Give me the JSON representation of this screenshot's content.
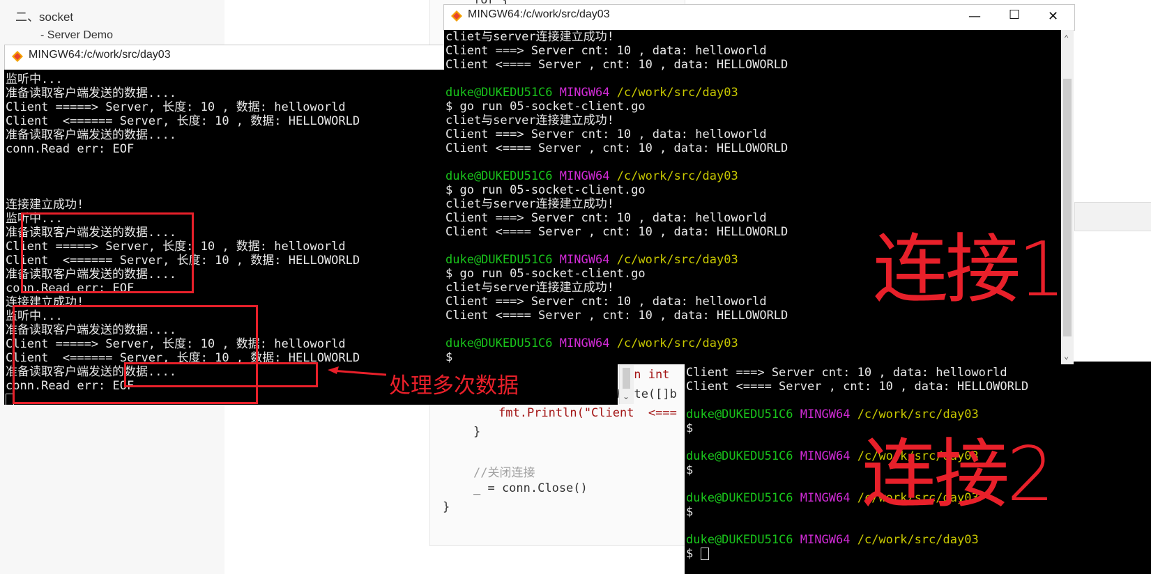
{
  "doc": {
    "toc_section": "二、socket",
    "toc_item": "- Server Demo"
  },
  "code": {
    "l1": "for {",
    "l2": "(n int",
    "l3": "cnt, err = conn.Write([]b",
    "l4_a": "fmt.Println(\"Client  <===",
    "l5": "}",
    "l6": "//关闭连接",
    "l7": "_ = conn.Close()",
    "l8": "}"
  },
  "win1": {
    "title": "MINGW64:/c/work/src/day03",
    "lines": [
      "监听中...",
      "准备读取客户端发送的数据....",
      "Client =====> Server, 长度: 10 , 数据: helloworld",
      "Client  <====== Server, 长度: 10 , 数据: HELLOWORLD",
      "准备读取客户端发送的数据....",
      "conn.Read err: EOF",
      "",
      "",
      "",
      "连接建立成功!",
      "监听中...",
      "准备读取客户端发送的数据....",
      "Client =====> Server, 长度: 10 , 数据: helloworld",
      "Client  <====== Server, 长度: 10 , 数据: HELLOWORLD",
      "准备读取客户端发送的数据....",
      "conn.Read err: EOF",
      "连接建立成功!",
      "监听中...",
      "准备读取客户端发送的数据....",
      "Client =====> Server, 长度: 10 , 数据: helloworld",
      "Client  <====== Server, 长度: 10 , 数据: HELLOWORLD",
      "准备读取客户端发送的数据....",
      "conn.Read err: EOF"
    ]
  },
  "win2": {
    "title": "MINGW64:/c/work/src/day03",
    "prompt_user": "duke@DUKEDU51C6",
    "prompt_sys": "MINGW64",
    "prompt_path": "/c/work/src/day03",
    "cmd": "$ go run 05-socket-client.go",
    "out1": "cliet与server连接建立成功!",
    "out2": "Client ===> Server cnt: 10 , data: helloworld",
    "out3": "Client <==== Server , cnt: 10 , data: HELLOWORLD",
    "dollar": "$"
  },
  "win3": {
    "line1": "Client ===> Server cnt: 10 , data: helloworld",
    "line2": "Client <==== Server , cnt: 10 , data: HELLOWORLD",
    "prompt_user": "duke@DUKEDU51C6",
    "prompt_sys": "MINGW64",
    "prompt_path": "/c/work/src/day03",
    "dollar": "$"
  },
  "annotations": {
    "conn1": "连接1",
    "conn2": "连接2",
    "multi": "处理多次数据"
  },
  "colors": {
    "annotation_red": "#e8202a",
    "prompt_green": "#19c41b",
    "prompt_magenta": "#d12bd6",
    "prompt_yellow": "#c8c800"
  }
}
